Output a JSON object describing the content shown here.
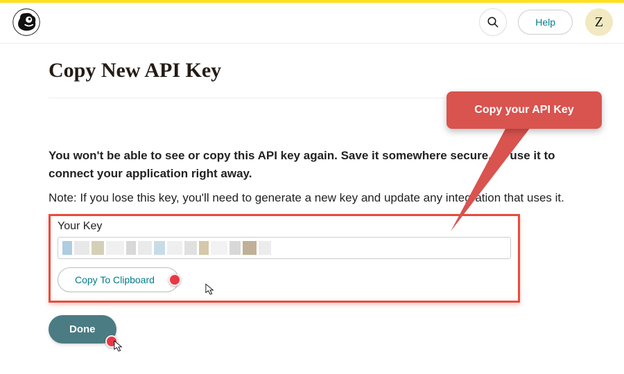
{
  "header": {
    "help_label": "Help",
    "avatar_letter": "Z"
  },
  "page": {
    "title": "Copy New API Key",
    "warning": "You won't be able to see or copy this API key again. Save it somewhere secure, or use it to connect your application right away.",
    "note": "Note: If you lose this key, you'll need to generate a new key and update any integration that uses it."
  },
  "key": {
    "label": "Your Key",
    "value_redacted": true,
    "copy_label": "Copy To Clipboard"
  },
  "actions": {
    "done_label": "Done"
  },
  "callout": {
    "text": "Copy your API Key"
  }
}
